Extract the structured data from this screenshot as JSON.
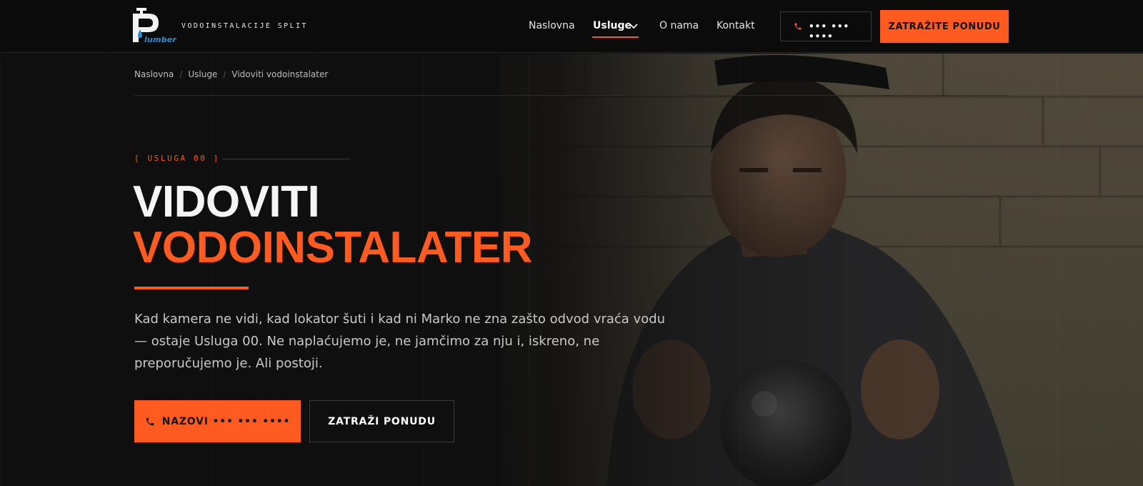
{
  "header": {
    "tagline": "VODOINSTALACIJE SPLIT",
    "logo_word": "lumber",
    "nav": [
      {
        "label": "Naslovna"
      },
      {
        "label": "Usluge",
        "active": true
      },
      {
        "label": "O nama"
      },
      {
        "label": "Kontakt"
      }
    ],
    "phone": "••• ••• ••••",
    "cta": "ZATRAŽITE PONUDU"
  },
  "breadcrumb": [
    "Naslovna",
    "Usluge",
    "Vidoviti vodoinstalater"
  ],
  "hero": {
    "eyebrow": "[ USLUGA 00 ]",
    "title_line1": "VIDOVITI",
    "title_line2": "VODOINSTALATER",
    "lead": "Kad kamera ne vidi, kad lokator šuti i kad ni Marko ne zna zašto odvod vraća vodu — ostaje Usluga 00. Ne naplaćujemo je, ne jamčimo za nju i, iskreno, ne preporučujemo je. Ali postoji.",
    "call_button": "NAZOVI ••• ••• ••••",
    "quote_button": "ZATRAŽI PONUDU"
  },
  "colors": {
    "accent": "#ff5a1f",
    "background": "#0f0f0f",
    "logo_blue": "#2a8fd6"
  },
  "icons": [
    "phone-icon",
    "chevron-down-icon",
    "faucet-logo"
  ]
}
